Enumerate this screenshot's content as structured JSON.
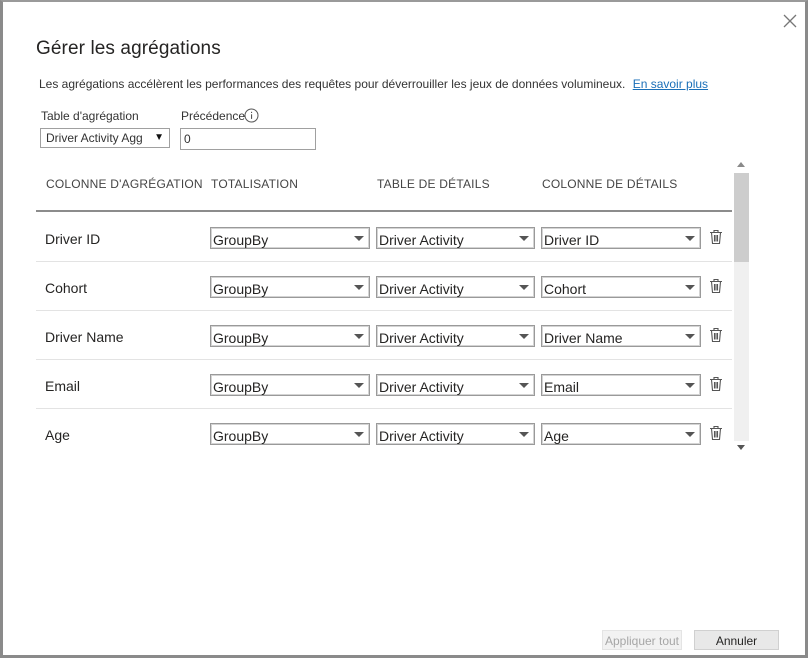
{
  "dialog": {
    "title": "Gérer les agrégations",
    "description": "Les agrégations accélèrent les performances des requêtes pour déverrouiller les jeux de données volumineux.",
    "learn_more": "En savoir plus"
  },
  "settings": {
    "agg_table_label": "Table d'agrégation",
    "agg_table_value": "Driver Activity Agg",
    "precedence_label": "Précédence",
    "precedence_value": "0"
  },
  "table": {
    "headers": [
      "COLONNE D'AGRÉGATION",
      "TOTALISATION",
      "TABLE DE DÉTAILS",
      "COLONNE DE DÉTAILS"
    ],
    "rows": [
      {
        "column": "Driver ID",
        "summarization": "GroupBy",
        "detail_table": "Driver Activity",
        "detail_column": "Driver ID"
      },
      {
        "column": "Cohort",
        "summarization": "GroupBy",
        "detail_table": "Driver Activity",
        "detail_column": "Cohort"
      },
      {
        "column": "Driver Name",
        "summarization": "GroupBy",
        "detail_table": "Driver Activity",
        "detail_column": "Driver Name"
      },
      {
        "column": "Email",
        "summarization": "GroupBy",
        "detail_table": "Driver Activity",
        "detail_column": "Email"
      },
      {
        "column": "Age",
        "summarization": "GroupBy",
        "detail_table": "Driver Activity",
        "detail_column": "Age"
      }
    ]
  },
  "footer": {
    "apply_label": "Appliquer tout",
    "cancel_label": "Annuler"
  },
  "icons": {
    "close": "close-icon",
    "info": "info-icon",
    "delete": "trash-icon",
    "dropdown": "chevron-down-icon"
  },
  "colors": {
    "link": "#1a6fb8",
    "disabled_text": "#a6a6a6",
    "header_rule": "#8c8c8c"
  }
}
